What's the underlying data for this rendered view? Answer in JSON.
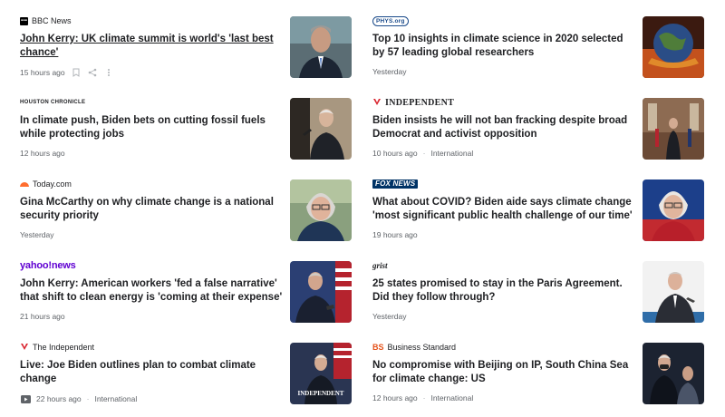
{
  "articles_left": [
    {
      "source": "BBC News",
      "headline": "John Kerry: UK climate summit is world's 'last best chance'",
      "time": "15 hours ago",
      "icons": [
        "save-icon",
        "share-icon",
        "more-icon"
      ]
    },
    {
      "source": "HOUSTON CHRONICLE",
      "headline": "In climate push, Biden bets on cutting fossil fuels while protecting jobs",
      "time": "12 hours ago"
    },
    {
      "source": "Today.com",
      "headline": "Gina McCarthy on why climate change is a national security priority",
      "time": "Yesterday"
    },
    {
      "source": "yahoo!news",
      "headline": "John Kerry: American workers 'fed a false narrative' that shift to clean energy is 'coming at their expense'",
      "time": "21 hours ago"
    },
    {
      "source": "The Independent",
      "headline": "Live: Joe Biden outlines plan to combat climate change",
      "time": "22 hours ago",
      "section": "International",
      "thumb_text": "INDEPENDENT"
    }
  ],
  "articles_right": [
    {
      "source": "PHYS.org",
      "headline": "Top 10 insights in climate science in 2020 selected by 57 leading global researchers",
      "time": "Yesterday"
    },
    {
      "source": "INDEPENDENT",
      "headline": "Biden insists he will not ban fracking despite broad Democrat and activist opposition",
      "time": "10 hours ago",
      "section": "International"
    },
    {
      "source": "FOX NEWS",
      "headline": "What about COVID? Biden aide says climate change 'most significant public health challenge of our time'",
      "time": "19 hours ago"
    },
    {
      "source": "grist",
      "headline": "25 states promised to stay in the Paris Agreement. Did they follow through?",
      "time": "Yesterday"
    },
    {
      "source": "Business Standard",
      "source_logo": "BS",
      "headline": "No compromise with Beijing on IP, South China Sea for climate change: US",
      "time": "12 hours ago",
      "section": "International"
    }
  ],
  "colors": {
    "bbc": "#000000",
    "independent_red": "#d9232e",
    "fox_blue": "#003366",
    "yahoo_purple": "#6001d2",
    "today_orange": "#ff6d2e",
    "bs_orange": "#e5531b"
  }
}
